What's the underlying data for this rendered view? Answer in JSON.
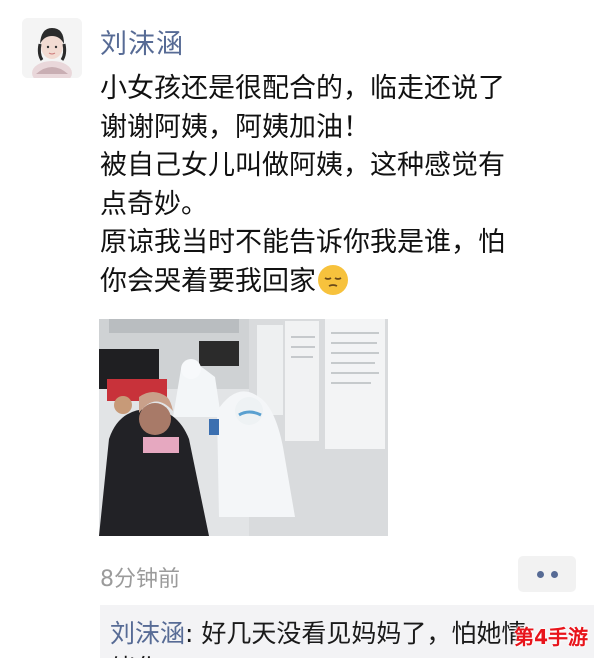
{
  "post": {
    "author": "刘沫涵",
    "lines": [
      "小女孩还是很配合的，临走还说了",
      "谢谢阿姨，阿姨加油！",
      "被自己女儿叫做阿姨，这种感觉有",
      "点奇妙。",
      "原谅我当时不能告诉你我是谁，怕",
      "你会哭着要我回家"
    ],
    "emoji": "pensive-face-emoji",
    "timestamp": "8分钟前"
  },
  "comment": {
    "author": "刘沫涵",
    "separator": ": ",
    "text": "好几天没看见妈妈了，怕她情",
    "text_line2": "绪化"
  },
  "watermark": "第4手游",
  "colors": {
    "link_blue": "#576b95",
    "timestamp_gray": "#9b9b9b",
    "comment_bg": "#f3f3f5",
    "watermark_red": "#e8141b"
  }
}
